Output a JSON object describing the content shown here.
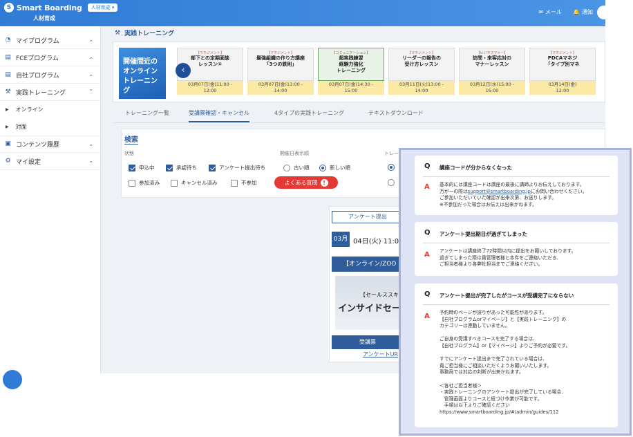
{
  "header": {
    "brand": "Smart Boarding",
    "org_select": "人材育成",
    "subtitle": "人材育成",
    "mail_label": "メール",
    "notify_label": "通知"
  },
  "sidebar": {
    "items": [
      {
        "label": "マイプログラム",
        "icon": "person-icon"
      },
      {
        "label": "FCEプログラム",
        "icon": "book-icon"
      },
      {
        "label": "自社プログラム",
        "icon": "book-icon"
      },
      {
        "label": "実践トレーニング",
        "icon": "training-icon"
      },
      {
        "label": "コンテンツ履歴",
        "icon": "history-icon"
      },
      {
        "label": "マイ設定",
        "icon": "gear-icon"
      }
    ],
    "subitems": [
      "オンライン",
      "対面"
    ]
  },
  "page_title": "実践トレーニング",
  "carousel": {
    "promo": "開催間近の\nオンライン\nトレーニング",
    "courses": [
      {
        "category": "【マネジメント】",
        "title": "部下との定期面談\nレッスン①",
        "date": "03月07日(金)11:00 -\n12:00"
      },
      {
        "category": "【マネジメント】",
        "title": "最強組織の作り方講座\n「3つの鉄則」",
        "date": "03月07日(金)13:00 -\n14:00"
      },
      {
        "category": "【コミュニケーション】",
        "title": "超実践練習\n経験力強化\nトレーニング",
        "date": "03月07日(金)14:30 -\n15:00"
      },
      {
        "category": "【マネジメント】",
        "title": "リーダーの報告の\n受け方レッスン",
        "date": "03月11日(火)13:00 -\n14:00"
      },
      {
        "category": "【ビジネスマナー】",
        "title": "訪問・来客応対の\nマナーレッスン",
        "date": "03月12日(水)15:00 -\n16:00"
      },
      {
        "category": "【マネジメント】",
        "title": "PDCAマネジ\n「タイプ別マネ",
        "date": "03月14日(金)\n12:00"
      }
    ]
  },
  "tabs": [
    "トレーニング一覧",
    "受講票確認・キャンセル",
    "4タイプの実践トレーニング",
    "テキストダウンロード"
  ],
  "search": {
    "title": "検索",
    "status_label": "状態",
    "date_order_label": "開催日表示順",
    "third_label": "トレー",
    "status_options": [
      {
        "label": "申込中",
        "checked": true
      },
      {
        "label": "承認待ち",
        "checked": true
      },
      {
        "label": "アンケート提出待ち",
        "checked": true
      },
      {
        "label": "参加済み",
        "checked": false
      },
      {
        "label": "キャンセル済み",
        "checked": false
      },
      {
        "label": "不参加",
        "checked": false
      }
    ],
    "order_options": [
      {
        "label": "古い順",
        "selected": false
      },
      {
        "label": "新しい順",
        "selected": true
      }
    ],
    "faq_button": "よくある質問"
  },
  "card": {
    "survey_button": "アンケート提出",
    "month": "03月",
    "date": "04日(火) 11:0",
    "band": "【オンライン/ZOO",
    "thumb_line1": "【セールススキ",
    "thumb_line2": "インサイドセー",
    "attend_button": "受講票",
    "survey_url": "アンケートUR"
  },
  "faq": [
    {
      "q": "講座コードが分からなくなった",
      "a_before": "基本的には講座コードは講座の最後に講師よりお伝えしております。\n万が一の際は",
      "a_link": "support@smartboarding.jp",
      "a_after": "にお問い合わせください。\nご参加いただいていた確認が出来次第、お送りします。\n※不参加だった場合はお伝えは出来かねます。"
    },
    {
      "q": "アンケート提出期日が過ぎてしまった",
      "a": "アンケートは講座終了72時間以内に提出をお願いしております。\n過ぎてしまった際は貴管理者様と本件をご連絡いただき、\nご担当者様より各弊社担当までご連絡ください。"
    },
    {
      "q": "アンケート提出が完了したがコースが受講完了にならない",
      "a": "予約時のページが誤りがあった可能性があります。\n【自社プログラムorマイページ】と【実践トレーニング】の\nカテゴリーは連動していません。\n\nご自身の受講すべきコースを完了する場合は、\n【自社プログラム】or【マイページ】よりご予約が必要です。\n\nすでにアンケート提出まで完了されている場合は、\n貴ご担当様にご相談いただくようお願いいたします。\n事務局では対応の判断が出来かねます。\n\n＜各社ご担当者様＞\n・実践トレーニングのアンケート提出が完了している場合、\n　管理画面よりコースと紐づけ作業が可能です。\n　手順は以下よりご確認ください\nhttps://www.smartboarding.jp/#/admin/guides/112"
    }
  ],
  "colors": {
    "primary": "#2f5d9c",
    "header": "#2f7bd6",
    "accent_red": "#e53935",
    "overlay_bg": "#dfe3f6"
  }
}
